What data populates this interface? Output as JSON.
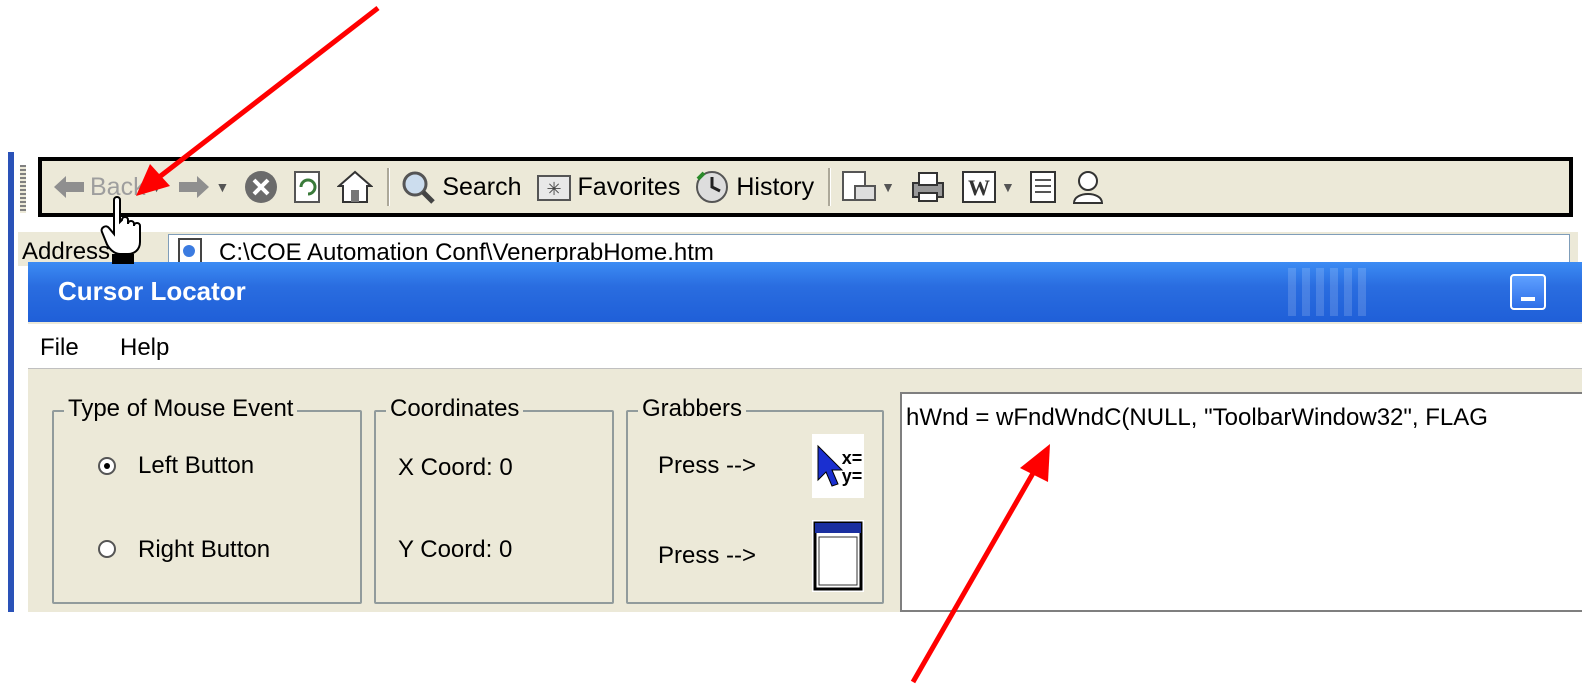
{
  "toolbar": {
    "back": "Back",
    "search": "Search",
    "favorites": "Favorites",
    "history": "History"
  },
  "address_bar": {
    "label": "Address",
    "value": "C:\\COE Automation Conf\\VenerprabHome.htm"
  },
  "window": {
    "title": "Cursor Locator",
    "menu": [
      "File",
      "Help"
    ],
    "mouse_event": {
      "label": "Type of Mouse Event",
      "options": [
        "Left Button",
        "Right Button"
      ],
      "selected": "Left Button"
    },
    "coordinates": {
      "label": "Coordinates",
      "x": "X Coord:  0",
      "y": "Y Coord:  0"
    },
    "grabbers": {
      "label": "Grabbers",
      "press1": "Press -->",
      "press2": "Press -->",
      "icon_text": "x=\ny="
    },
    "output": "hWnd = wFndWndC(NULL, \"ToolbarWindow32\", FLAG"
  },
  "colors": {
    "titlebar": "#1f5fd8",
    "annotation_arrow": "#ff0000",
    "window_bg": "#ece9d8"
  }
}
